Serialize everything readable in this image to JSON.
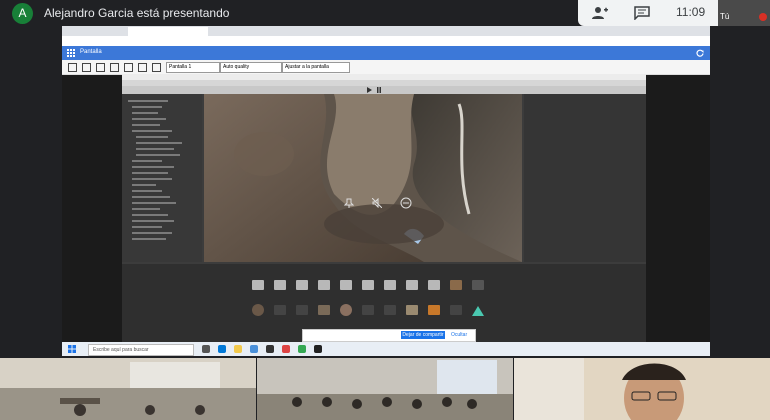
{
  "meet": {
    "presenter_initial": "A",
    "presenter_text": "Alejandro Garcia está presentando",
    "clock": "11:09",
    "self_label": "Tú",
    "icons": [
      "people-icon",
      "chat-icon"
    ]
  },
  "shared_screen": {
    "viewer": {
      "title": "Pantalla",
      "screen_select": "Pantalla 1",
      "quality_select": "Auto quality",
      "fit_select": "Ajustar a la pantalla"
    },
    "windows_search_placeholder": "Escribe aquí para buscar",
    "share_notification": {
      "stop_label": "Dejar de compartir",
      "hide_label": "Ocultar"
    }
  },
  "colors": {
    "meet_bg": "#202124",
    "avatar": "#188038",
    "viewer_bar": "#3c78d8",
    "stop_button": "#1a73e8",
    "mic_off": "#d93025"
  }
}
